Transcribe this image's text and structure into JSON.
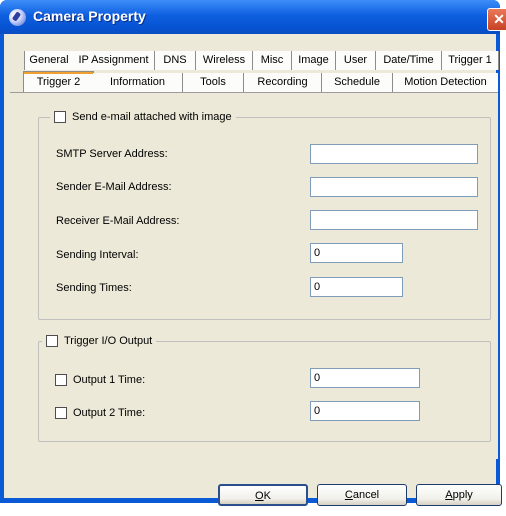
{
  "window": {
    "title": "Camera Property",
    "close_glyph": "✕"
  },
  "tabs": {
    "row1": [
      "General",
      "IP Assignment",
      "DNS",
      "Wireless",
      "Misc",
      "Image",
      "User",
      "Date/Time",
      "Trigger 1"
    ],
    "row2": [
      "Trigger 2",
      "Information",
      "Tools",
      "Recording",
      "Schedule",
      "Motion Detection"
    ],
    "active": "Trigger 2"
  },
  "email_group": {
    "checkbox_label": "Send e-mail attached with image",
    "checked": false,
    "fields": [
      {
        "label": "SMTP Server Address:",
        "value": ""
      },
      {
        "label": "Sender E-Mail Address:",
        "value": ""
      },
      {
        "label": "Receiver E-Mail Address:",
        "value": ""
      },
      {
        "label": "Sending Interval:",
        "value": "0"
      },
      {
        "label": "Sending Times:",
        "value": "0"
      }
    ]
  },
  "io_group": {
    "checkbox_label": "Trigger I/O Output",
    "checked": false,
    "outputs": [
      {
        "label": "Output 1 Time:",
        "value": "0",
        "checked": false
      },
      {
        "label": "Output 2 Time:",
        "value": "0",
        "checked": false
      }
    ]
  },
  "buttons": {
    "ok": {
      "mnemonic": "O",
      "rest": "K"
    },
    "cancel": {
      "mnemonic": "C",
      "rest": "ancel"
    },
    "apply": {
      "mnemonic": "A",
      "rest": "pply"
    }
  }
}
